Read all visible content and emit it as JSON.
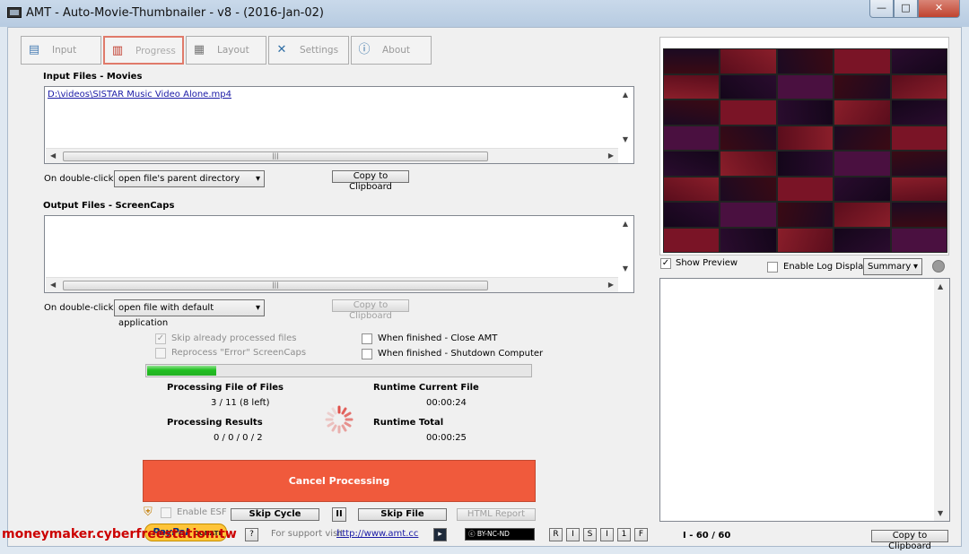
{
  "window": {
    "title": "AMT - Auto-Movie-Thumbnailer - v8 - (2016-Jan-02)",
    "minimize": "—",
    "maximize": "□",
    "close": "✕"
  },
  "tabs": [
    {
      "label": "Input",
      "icon": "input-icon"
    },
    {
      "label": "Progress",
      "icon": "progress-icon"
    },
    {
      "label": "Layout",
      "icon": "layout-icon"
    },
    {
      "label": "Settings",
      "icon": "settings-icon"
    },
    {
      "label": "About",
      "icon": "about-icon"
    }
  ],
  "input": {
    "title": "Input Files - Movies",
    "file": "D:\\videos\\SISTAR Music Video Alone.mp4",
    "double_click_label": "On double-click",
    "double_click_value": "open file's parent directory",
    "copy_label": "Copy to Clipboard"
  },
  "output": {
    "title": "Output Files - ScreenCaps",
    "double_click_label": "On double-click",
    "double_click_value": "open file with default application",
    "copy_label": "Copy to Clipboard"
  },
  "options": {
    "skip_processed": "Skip already processed files",
    "reprocess_error": "Reprocess \"Error\" ScreenCaps",
    "close_amt": "When finished - Close AMT",
    "shutdown": "When finished - Shutdown Computer"
  },
  "progress": {
    "fraction": 0.18,
    "files_label": "Processing File of Files",
    "files_value": "3 / 11 (8 left)",
    "results_label": "Processing Results",
    "results_value": "0 / 0 / 0 / 2",
    "runtime_current_label": "Runtime Current File",
    "runtime_current_value": "00:00:24",
    "runtime_total_label": "Runtime Total",
    "runtime_total_value": "00:00:25"
  },
  "cancel_label": "Cancel Processing",
  "bottom": {
    "enable_esf": "Enable ESF",
    "skip_cycle": "Skip Cycle",
    "pause": "II",
    "skip_file": "Skip File",
    "html_report": "HTML Report",
    "paypal": "PayPal",
    "donate": "DONATE",
    "support_text": "For support visit",
    "support_link": "http://www.amt.cc",
    "license": "BY-NC-ND",
    "toggles": [
      "R",
      "I",
      "S",
      "I",
      "1",
      "F"
    ]
  },
  "right": {
    "show_preview": "Show Preview",
    "enable_log": "Enable Log Display",
    "log_mode": "Summary",
    "range": "I - 60 / 60",
    "copy_label": "Copy to Clipboard"
  },
  "watermark": "moneymaker.cyberfreestation.tw"
}
